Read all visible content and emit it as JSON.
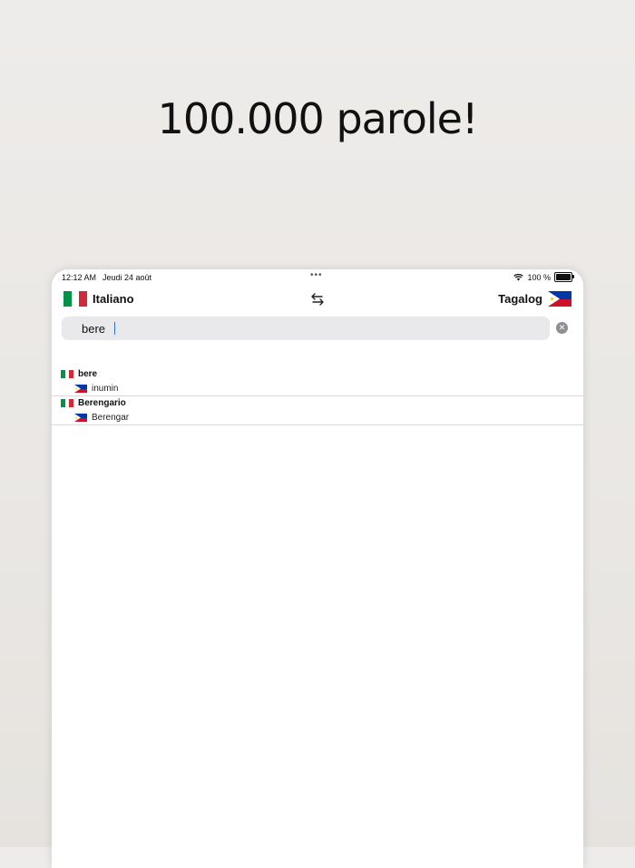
{
  "headline": "100.000 parole!",
  "status_bar": {
    "time": "12:12 AM",
    "date": "Jeudi 24 août",
    "battery_percent": "100 %",
    "battery_level": 1.0
  },
  "nav": {
    "source_language": "Italiano",
    "target_language": "Tagalog",
    "source_flag": "italy-flag",
    "target_flag": "philippines-flag",
    "swap_icon": "swap-arrows-icon"
  },
  "search": {
    "value": "bere",
    "clear_icon": "clear-icon"
  },
  "results": [
    {
      "word": "bere",
      "translation": "inumin"
    },
    {
      "word": "Berengario",
      "translation": "Berengar"
    }
  ],
  "colors": {
    "italy_green": "#009246",
    "italy_white": "#ffffff",
    "italy_red": "#ce2b37",
    "ph_blue": "#0038a8",
    "ph_red": "#ce1126",
    "ph_yellow": "#fcd116",
    "search_bg": "#e9e9eb"
  }
}
